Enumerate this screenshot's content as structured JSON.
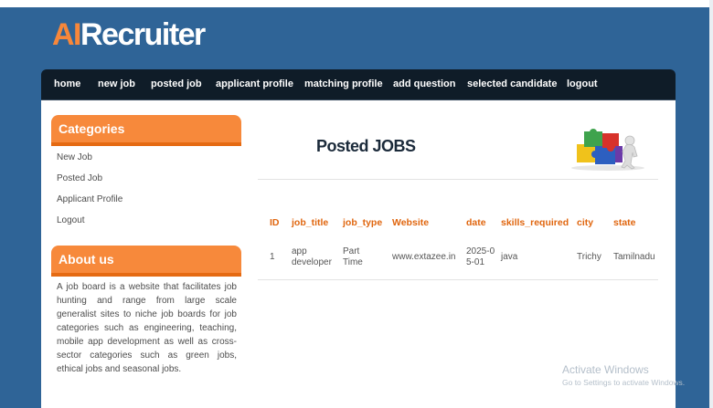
{
  "logo": {
    "ai": "AI",
    "rest": "Recruiter"
  },
  "nav": [
    "home",
    "new job",
    "posted job",
    "applicant profile",
    "matching profile",
    "add question",
    "selected candidate",
    "logout"
  ],
  "sidebar": {
    "categories_title": "Categories",
    "categories": [
      "New Job",
      "Posted Job",
      "Applicant Profile",
      "Logout"
    ],
    "about_title": "About us",
    "about_text": "A job board is a website that facilitates job hunting and range from large scale generalist sites to niche job boards for job categories such as engineering, teaching, mobile app development as well as cross-sector categories such as green jobs, ethical jobs and seasonal jobs."
  },
  "content": {
    "title": "Posted JOBS",
    "illustration": "puzzle-people-icon"
  },
  "table": {
    "headers": [
      "ID",
      "job_title",
      "job_type",
      "Website",
      "date",
      "skills_required",
      "city",
      "state"
    ],
    "rows": [
      {
        "id": "1",
        "job_title": "app developer",
        "job_type": "Part Time",
        "website": "www.extazee.in",
        "date": "2025-05-01",
        "skills_required": "java",
        "city": "Trichy",
        "state": "Tamilnadu"
      }
    ]
  },
  "watermark": {
    "line1": "Activate Windows",
    "line2": "Go to Settings to activate Windows."
  },
  "colors": {
    "background": "#2f6497",
    "accent": "#f7893b",
    "nav": "#0f1c28",
    "header_text": "#e0660f"
  }
}
